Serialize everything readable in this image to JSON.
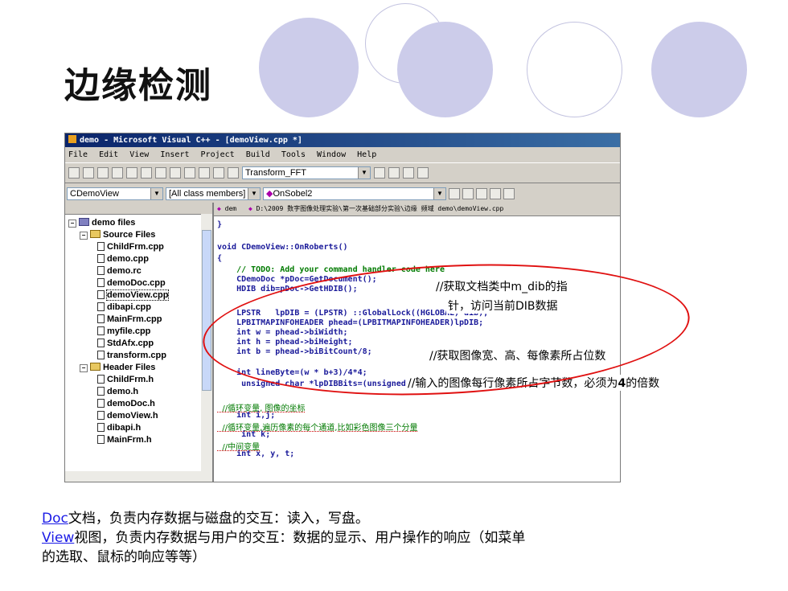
{
  "slide": {
    "title": "边缘检测"
  },
  "window": {
    "title": "demo - Microsoft Visual C++ - [demoView.cpp *]",
    "menu": [
      "File",
      "Edit",
      "View",
      "Insert",
      "Project",
      "Build",
      "Tools",
      "Window",
      "Help"
    ],
    "toolbar_combo": "Transform_FFT",
    "class_combo": "CDemoView",
    "filter_combo": "[All class members]",
    "member_combo": "OnSobel2",
    "editor_nav_left": "dem",
    "editor_path": "D:\\2009 数字图像处理实验\\第一次基础部分实验\\边缘 频域 demo\\demoView.cpp"
  },
  "tree": {
    "root": "demo files",
    "source_folder": "Source Files",
    "source_files": [
      "ChildFrm.cpp",
      "demo.cpp",
      "demo.rc",
      "demoDoc.cpp",
      "demoView.cpp",
      "dibapi.cpp",
      "MainFrm.cpp",
      "myfile.cpp",
      "StdAfx.cpp",
      "transform.cpp"
    ],
    "header_folder": "Header Files",
    "header_files": [
      "ChildFrm.h",
      "demo.h",
      "demoDoc.h",
      "demoView.h",
      "dibapi.h",
      "MainFrm.h"
    ]
  },
  "code": [
    "}",
    "",
    "void CDemoView::OnRoberts()",
    "{",
    "    // TODO: Add your command handler code here",
    "    CDemoDoc *pDoc=GetDocument();",
    "    HDIB dib=pDoc->GetHDIB();",
    "",
    "    LPSTR   lpDIB = (LPSTR) ::GlobalLock((HGLOBAL) dib);",
    "    LPBITMAPINFOHEADER phead=(LPBITMAPINFOHEADER)lpDIB;",
    "    int w = phead->biWidth;",
    "    int h = phead->biHeight;",
    "    int b = phead->biBitCount/8;",
    "",
    "    int lineByte=(w * b+3)/4*4;",
    "     unsigned char *lpDIBBits=(unsigned char *)::FindDIBBits(lpDIB);",
    "",
    "  //循环变量, 图像的坐标",
    "    int i,j;",
    "  //循环变量,遍历像素的每个通道,比如彩色图像三个分量",
    "     int k;",
    "  //中间变量",
    "    int x, y, t;"
  ],
  "annotations": {
    "a1_line1": "//获取文档类中m_dib的指",
    "a1_line2": "针，访问当前DIB数据",
    "a2": "//获取图像宽、高、每像素所占位数",
    "a3_pre": "//输入的图像每行像素所占字节数，必须为",
    "a3_num": "4",
    "a3_post": "的倍数"
  },
  "notes": {
    "doc_link": "Doc",
    "doc_text": "文档，负责内存数据与磁盘的交互：读入，写盘。",
    "view_link": "View",
    "view_text": "视图，负责内存数据与用户的交互：数据的显示、用户操作的响应（如菜单",
    "view_text2": "的选取、鼠标的响应等等）"
  },
  "colors": {
    "circle": "#ccccea",
    "ellipse": "#e01010",
    "link": "#1a1ae6"
  }
}
